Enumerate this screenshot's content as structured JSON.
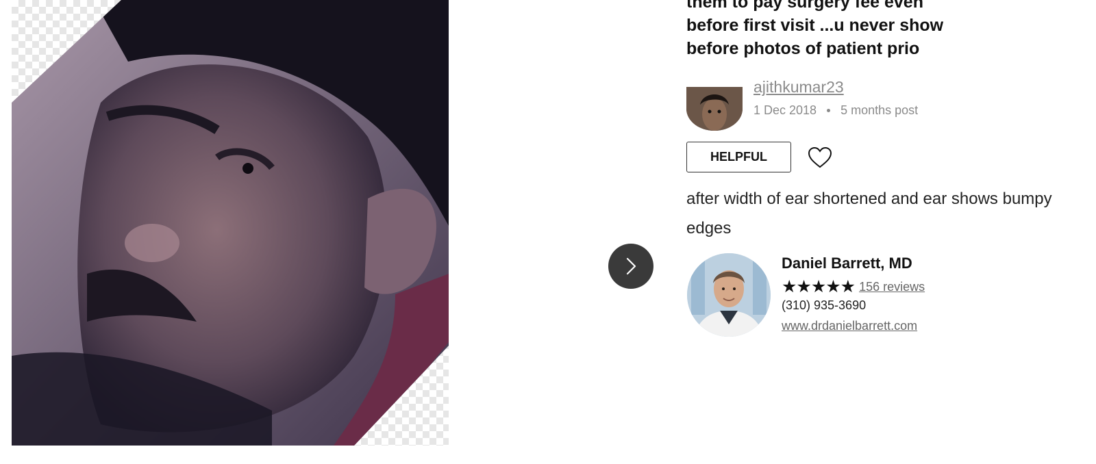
{
  "review": {
    "title_lines": [
      "them to pay surgery fee even",
      "before first visit ...u never show",
      "before photos of patient prio"
    ],
    "author": "ajithkumar23",
    "date": "1 Dec 2018",
    "post_age": "5 months post",
    "helpful_label": "HELPFUL",
    "body": "after width of ear shortened and ear shows bumpy edges"
  },
  "doctor": {
    "name": "Daniel Barrett, MD",
    "stars": "★★★★★",
    "reviews": "156 reviews",
    "phone": "(310) 935-3690",
    "website": "www.drdanielbarrett.com"
  },
  "icons": {
    "next": "chevron-right-icon",
    "like": "heart-outline-icon"
  },
  "colors": {
    "arrow_bg": "#3a3a3a",
    "muted_text": "#8a8a8a",
    "link_text": "#666666"
  }
}
